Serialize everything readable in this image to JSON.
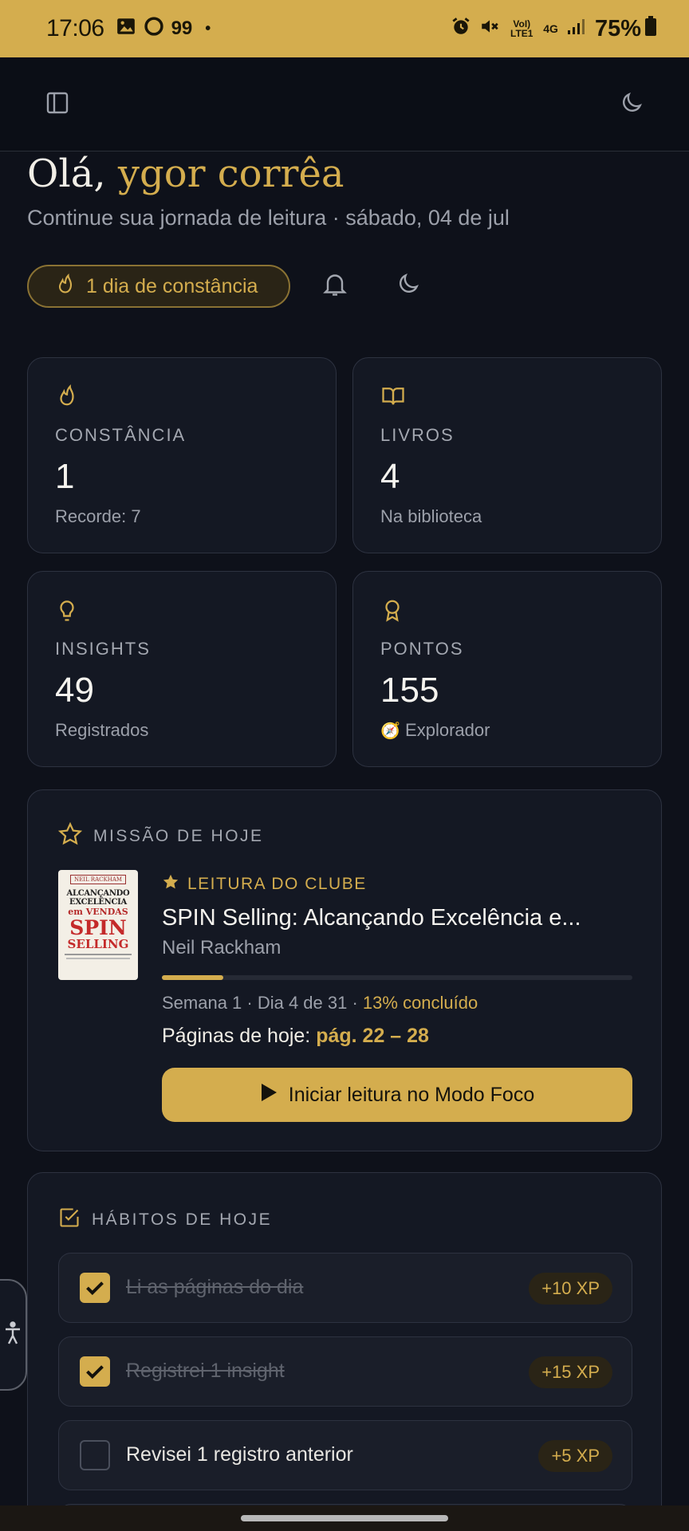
{
  "status_bar": {
    "time": "17:06",
    "notif_count": "99",
    "volte": "VoI) LTE1",
    "network": "4G",
    "battery": "75%"
  },
  "greeting": {
    "hello": "Olá,",
    "name": "ygor corrêa",
    "subtitle": "Continue sua jornada de leitura · sábado, 04 de jul"
  },
  "streak_pill": "1 dia de constância",
  "stats": [
    {
      "label": "CONSTÂNCIA",
      "value": "1",
      "note": "Recorde: 7",
      "icon": "flame-icon"
    },
    {
      "label": "LIVROS",
      "value": "4",
      "note": "Na biblioteca",
      "icon": "book-open-icon"
    },
    {
      "label": "INSIGHTS",
      "value": "49",
      "note": "Registrados",
      "icon": "lightbulb-icon"
    },
    {
      "label": "PONTOS",
      "value": "155",
      "note": "Explorador",
      "note_icon": "🧭",
      "icon": "award-icon"
    }
  ],
  "mission": {
    "title": "MISSÃO DE HOJE",
    "tag": "LEITURA DO CLUBE",
    "book_title": "SPIN Selling: Alcançando Excelência e...",
    "author": "Neil Rackham",
    "progress": 0.13,
    "meta": "Semana 1 · Dia 4 de 31 · ",
    "meta_percent": "13% concluído",
    "pages_label": "Páginas de hoje: ",
    "pages_value": "pág. 22 – 28",
    "cta": "Iniciar leitura no Modo Foco",
    "cover": {
      "line1": "NEIL RACKHAM",
      "line2": "ALCANÇANDO",
      "line3": "EXCELÊNCIA",
      "line4": "em VENDAS",
      "line5": "SPIN",
      "line6": "SELLING"
    }
  },
  "habits": {
    "title": "HÁBITOS DE HOJE",
    "items": [
      {
        "label": "Li as páginas do dia",
        "xp": "+10 XP",
        "done": true
      },
      {
        "label": "Registrei 1 insight",
        "xp": "+15 XP",
        "done": true
      },
      {
        "label": "Revisei 1 registro anterior",
        "xp": "+5 XP",
        "done": false
      }
    ]
  },
  "colors": {
    "accent": "#d4ad4e",
    "background": "#0e111a",
    "card": "#141823"
  }
}
